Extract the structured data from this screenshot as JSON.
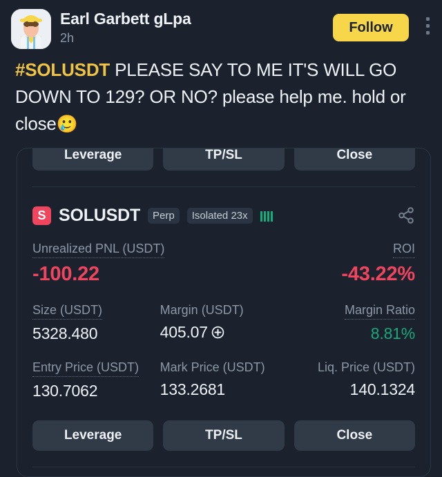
{
  "post": {
    "author": "Earl Garbett gLpa",
    "timestamp": "2h",
    "follow_label": "Follow",
    "avatar_icon": "farmer-avatar",
    "menu_icon": "kebab-menu-icon",
    "text_hashtag": "#SOLUSDT",
    "text_body": " PLEASE SAY TO ME IT'S WILL GO DOWN TO 129? OR NO? please help me. hold or close",
    "text_emoji": "🥲"
  },
  "card": {
    "top_actions": [
      {
        "label": "Leverage",
        "name": "leverage"
      },
      {
        "label": "TP/SL",
        "name": "tpsl"
      },
      {
        "label": "Close",
        "name": "close"
      }
    ],
    "symbol": {
      "coin_letter": "S",
      "name": "SOLUSDT",
      "contract_type": "Perp",
      "margin_mode": "Isolated 23x",
      "share_icon": "share-icon",
      "signal_icon": "signal-bars-icon"
    },
    "rows": [
      {
        "cells": [
          {
            "label": "Unrealized PNL (USDT)",
            "value": "-100.22",
            "tone": "neg",
            "size": "big",
            "align": "left",
            "dotted": true,
            "name": "unrealized-pnl"
          },
          {
            "label": "ROI",
            "value": "-43.22%",
            "tone": "neg",
            "size": "big",
            "align": "right",
            "dotted": true,
            "name": "roi"
          }
        ]
      },
      {
        "cells": [
          {
            "label": "Size (USDT)",
            "value": "5328.480",
            "tone": "",
            "size": "",
            "align": "left",
            "dotted": true,
            "name": "size"
          },
          {
            "label": "Margin (USDT)",
            "value": "405.07",
            "tone": "",
            "size": "",
            "align": "left",
            "dotted": false,
            "name": "margin",
            "plus": true
          },
          {
            "label": "Margin Ratio",
            "value": "8.81%",
            "tone": "pos",
            "size": "",
            "align": "right",
            "dotted": true,
            "name": "margin-ratio"
          }
        ]
      },
      {
        "cells": [
          {
            "label": "Entry Price (USDT)",
            "value": "130.7062",
            "tone": "",
            "size": "",
            "align": "left",
            "dotted": true,
            "name": "entry-price"
          },
          {
            "label": "Mark Price (USDT)",
            "value": "133.2681",
            "tone": "",
            "size": "",
            "align": "left",
            "dotted": false,
            "name": "mark-price"
          },
          {
            "label": "Liq. Price (USDT)",
            "value": "140.1324",
            "tone": "",
            "size": "",
            "align": "right",
            "dotted": false,
            "name": "liq-price"
          }
        ]
      }
    ],
    "bottom_actions": [
      {
        "label": "Leverage",
        "name": "leverage"
      },
      {
        "label": "TP/SL",
        "name": "tpsl"
      },
      {
        "label": "Close",
        "name": "close"
      }
    ]
  },
  "colors": {
    "background": "#1b222e",
    "accent_yellow": "#f7d64a",
    "negative_red": "#f0455f",
    "positive_green": "#1aa87a",
    "button_gray": "#313a47"
  }
}
